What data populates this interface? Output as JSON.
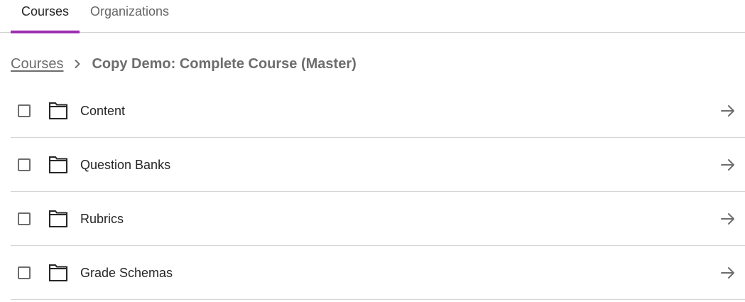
{
  "tabs": [
    {
      "label": "Courses",
      "active": true
    },
    {
      "label": "Organizations",
      "active": false
    }
  ],
  "colors": {
    "accent": "#9b2fae",
    "text": "#262626",
    "muted": "#6d6d6d",
    "divider": "#d4d4d4"
  },
  "breadcrumb": {
    "root": "Courses",
    "separator_icon": "chevron-right-icon",
    "current": "Copy Demo: Complete Course (Master)"
  },
  "items": [
    {
      "label": "Content",
      "checked": false,
      "icon": "folder-icon",
      "action_icon": "arrow-right-icon"
    },
    {
      "label": "Question Banks",
      "checked": false,
      "icon": "folder-icon",
      "action_icon": "arrow-right-icon"
    },
    {
      "label": "Rubrics",
      "checked": false,
      "icon": "folder-icon",
      "action_icon": "arrow-right-icon"
    },
    {
      "label": "Grade Schemas",
      "checked": false,
      "icon": "folder-icon",
      "action_icon": "arrow-right-icon"
    }
  ]
}
